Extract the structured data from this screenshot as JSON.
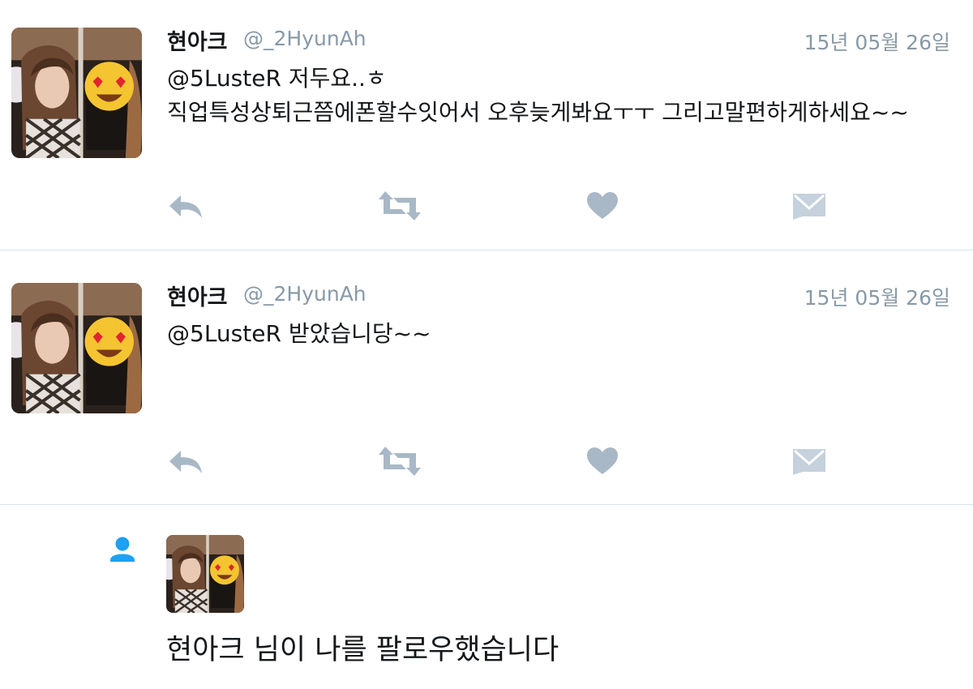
{
  "colors": {
    "text": "#14171a",
    "secondary": "#8899a6",
    "icon": "#a9b8c6",
    "accent": "#1da1f2",
    "divider": "#dbe3ea"
  },
  "tweets": [
    {
      "display_name": "현아크",
      "handle": "@_2HyunAh",
      "date": "15년 05월 26일",
      "mention": "@5LusteR",
      "lines": [
        "저두요..ㅎ",
        "직업특성상퇴근쯤에폰할수잇어서 오후늦게봐요ㅜㅜ 그리고말편하게하세요~~"
      ],
      "actions": [
        "reply-icon",
        "retweet-icon",
        "heart-icon",
        "direct-message-icon"
      ]
    },
    {
      "display_name": "현아크",
      "handle": "@_2HyunAh",
      "date": "15년 05월 26일",
      "mention": "@5LusteR",
      "lines": [
        "받았습니당~~"
      ],
      "actions": [
        "reply-icon",
        "retweet-icon",
        "heart-icon",
        "direct-message-icon"
      ]
    }
  ],
  "follow_notification": {
    "icon": "person-icon",
    "text": "현아크 님이 나를 팔로우했습니다"
  }
}
